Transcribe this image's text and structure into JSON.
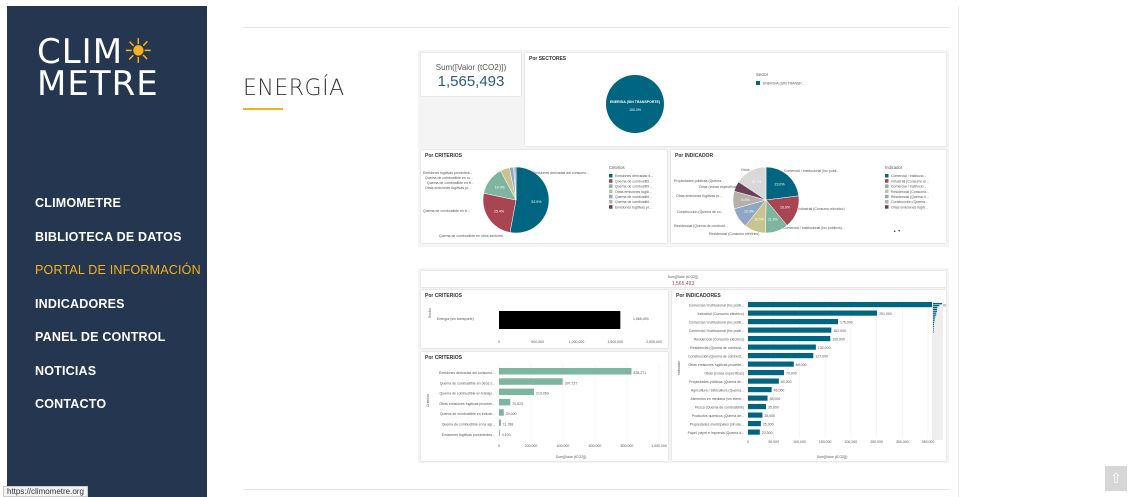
{
  "logo": {
    "line1": "CLIM",
    "line1_sun": "☀",
    "line2": "METRE"
  },
  "nav": [
    {
      "label": "CLIMOMETRE",
      "active": false
    },
    {
      "label": "BIBLIOTECA DE DATOS",
      "active": false
    },
    {
      "label": "PORTAL DE INFORMACIÓN",
      "active": true
    },
    {
      "label": "INDICADORES",
      "active": false
    },
    {
      "label": "PANEL DE CONTROL",
      "active": false
    },
    {
      "label": "NOTICIAS",
      "active": false
    },
    {
      "label": "CONTACTO",
      "active": false
    }
  ],
  "status_url": "https://climometre.org",
  "page_title": "ENERGÍA",
  "colors": {
    "sidebar": "#243650",
    "accent": "#f5b21b",
    "primary": "#006580",
    "red": "#a94451",
    "green": "#7eb5a0"
  },
  "kpi": {
    "label": "Sum([Valor (tCO2)])",
    "value": "1,565,493"
  },
  "sectores": {
    "title": "Por SECTORES",
    "legend_title": "Sector",
    "legend": [
      "ENERGIA (SIN TRANSP..."
    ],
    "slice_label": "ENERGIA (SIN TRANSPORTE)",
    "slice_pct": "100.0%"
  },
  "criterios_pie": {
    "title": "Por CRITERIOS",
    "legend_title": "Criterios",
    "legend": [
      "Emisiones derivadas d...",
      "Quema de combustibl...",
      "Quema de combustibl...",
      "Otras emisiones fugiti...",
      "Quema de combustibl...",
      "Quema de combustibl...",
      "Emisiones fugitivas pr..."
    ],
    "labels": [
      "Emisiones fugitivas procedent...",
      "Quema de combustible en tu...",
      "Quema de combustible en tr...",
      "Otras emisiones fugitivas pr...",
      "Quema de combustible en tr...",
      "Emisiones derivadas del consumo...",
      "Quema de combustible en otros sectores"
    ]
  },
  "indicador_pie": {
    "title": "Por INDICADOR",
    "legend_title": "Indicador",
    "legend": [
      "Comercial / Institucio...",
      "Industrial (Consumo el...",
      "Comercial / Institucio...",
      "Residencial (Consumo...",
      "Residencial (Quema d...",
      "Construcción (Quema...",
      "Otras emisiones fugiti..."
    ],
    "labels": [
      "Otros",
      "Propiedades públicas (Quema...",
      "Otras (zonas específicas)",
      "Otras emisiones fugitivas pr...",
      "Construcción (Quema de co...",
      "Residencial (Quema de combust...",
      "Residencial (Consumo eléctrico)",
      "Comercial / Institucional (Inc públi...",
      "Industrial (Consumo eléctrico)",
      "Comercial / Institucional (Inc públicos)..."
    ],
    "pager": "▲ ▼"
  },
  "total_bar": {
    "label": "Sum([Valor (tCO2)])",
    "value": "1,565,493"
  },
  "criterios_bar1": {
    "title": "Por CRITERIOS",
    "y_label": "Sector",
    "category": "Energía (sin transporte)",
    "value_label": "1,565,493",
    "ticks": [
      "0",
      "500,000",
      "1,000,000",
      "1,500,000",
      "2,000,000"
    ]
  },
  "criterios_bar2": {
    "title": "Por CRITERIOS",
    "y_label": "Criterios",
    "x_label": "Sum([Valor (tCO2)])",
    "ticks": [
      "0",
      "200,000",
      "400,000",
      "600,000",
      "800,000",
      "1,000,000"
    ]
  },
  "indicadores_bar": {
    "title": "Por INDICADORES",
    "y_label": "Indicador",
    "x_label": "Sum([Valor (tCO2)])",
    "ticks": [
      "0",
      "50,000",
      "100,000",
      "150,000",
      "200,000",
      "250,000",
      "300,000",
      "350,000"
    ]
  },
  "chart_data": [
    {
      "type": "pie",
      "title": "Por SECTORES",
      "categories": [
        "ENERGIA (SIN TRANSPORTE)"
      ],
      "values": [
        100.0
      ]
    },
    {
      "type": "pie",
      "title": "Por CRITERIOS",
      "categories": [
        "Emisiones derivadas d...",
        "Quema de combustibl...",
        "Quema de combustibl...",
        "Otras emisiones fugiti...",
        "Quema de combustibl...",
        "Quema de combustibl...",
        "Emisiones fugitivas pr..."
      ],
      "values": [
        52.9,
        25.4,
        14.0,
        4.5,
        2.0,
        0.7,
        0.5
      ]
    },
    {
      "type": "pie",
      "title": "Por INDICADOR",
      "categories": [
        "Comercial / Institucio...",
        "Industrial (Consumo el...",
        "Comercial / Institucio...",
        "Residencial (Consumo...",
        "Residencial (Quema d...",
        "Construcción (Quema...",
        "Otras emisiones fugiti...",
        "Otros"
      ],
      "values": [
        23.0,
        16.0,
        11.2,
        10.5,
        10.0,
        8.6,
        5.0,
        15.7
      ]
    },
    {
      "type": "bar",
      "title": "Por CRITERIOS",
      "categories": [
        "Energía (sin transporte)"
      ],
      "values": [
        1565493
      ],
      "xlim": [
        0,
        2000000
      ]
    },
    {
      "type": "bar",
      "title": "Por CRITERIOS",
      "xlabel": "Sum([Valor (tCO2)])",
      "ylabel": "Criterios",
      "categories": [
        "Emisiones derivadas del consumo...",
        "Quema de combustible en otros s...",
        "Quema de combustible en trabajo...",
        "Otras emisiones fugitivas procede...",
        "Quema de combustible en industr...",
        "Quema de combustible en la agr...",
        "Emisiones fugitivas procedentes..."
      ],
      "values": [
        828271,
        397727,
        219059,
        70623,
        30000,
        11788,
        4100
      ],
      "xlim": [
        0,
        1000000
      ]
    },
    {
      "type": "bar",
      "title": "Por INDICADORES",
      "xlabel": "Sum([Valor (tCO2)])",
      "ylabel": "Indicador",
      "categories": [
        "Comercial / Institucional (Inc públi...",
        "Industrial (Consumo eléctrico)",
        "Comercial / Institucional (Inc públi...",
        "Comercial / Institucional (Inc públi...",
        "Residencial (Consumo eléctrico)",
        "Residencial (Quema de combust...",
        "Construcción (Quema de combust...",
        "Otras emisiones fugitivas procede...",
        "Otras (zonas específicas)",
        "Propiedades públicas (Quema de...",
        "Agricultura / Silvicultura (Quema...",
        "Alimentos en mediana (sin electr...",
        "Pesca (Quema de combustible)",
        "Productos químicos (Quema de...",
        "Propiedades municipales (sin ele...",
        "Papel, papel e imprenta (Quema d..."
      ],
      "values": [
        359000,
        251000,
        175000,
        162000,
        160000,
        132000,
        127000,
        89000,
        70000,
        60000,
        46000,
        38000,
        35000,
        28000,
        25000,
        23000
      ],
      "xlim": [
        0,
        350000
      ]
    }
  ]
}
